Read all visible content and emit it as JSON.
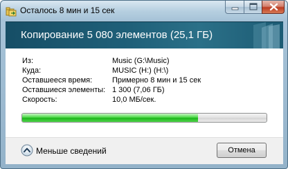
{
  "window": {
    "title": "Осталось 8 мин и 15 сек"
  },
  "header": {
    "title": "Копирование 5 080 элементов (25,1 ГБ)"
  },
  "details": {
    "from": {
      "label": "Из:",
      "value": "Music (G:\\Music)"
    },
    "to": {
      "label": "Куда:",
      "value": "MUSIC (H:) (H:\\)"
    },
    "time_left": {
      "label": "Оставшееся время:",
      "value": "Примерно 8 мин и 15 сек"
    },
    "items_left": {
      "label": "Оставшиеся элементы:",
      "value": "1 300 (7,06 ГБ)"
    },
    "speed": {
      "label": "Скорость:",
      "value": "10,0 МБ/сек."
    }
  },
  "progress": {
    "fraction": 0.72,
    "color": "#1cb41a"
  },
  "footer": {
    "toggle_label": "Меньше сведений",
    "cancel_label": "Отмена"
  },
  "icons": {
    "window_icon": "folder-copy-icon",
    "toggle_icon": "chevron-up-circle-icon"
  }
}
